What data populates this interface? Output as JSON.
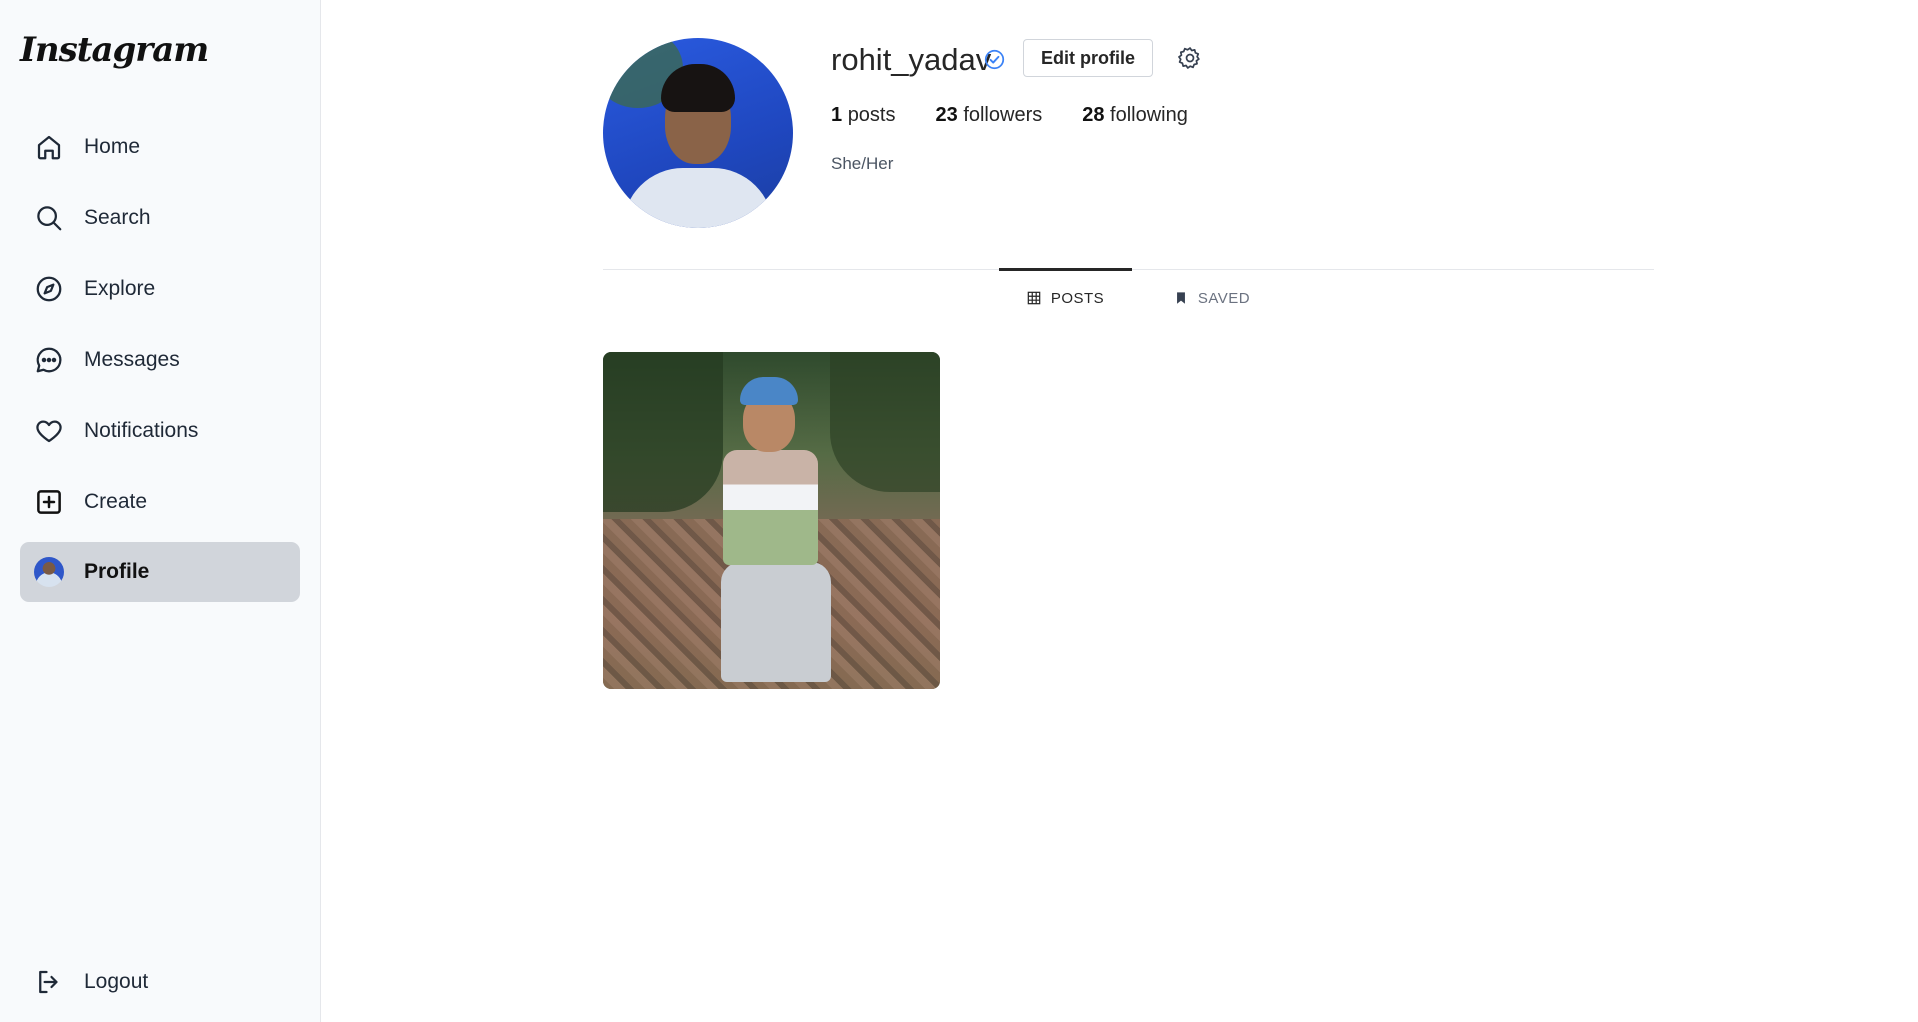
{
  "app": {
    "logo": "Instagram"
  },
  "sidebar": {
    "items": [
      {
        "label": "Home",
        "icon": "home-icon"
      },
      {
        "label": "Search",
        "icon": "search-icon"
      },
      {
        "label": "Explore",
        "icon": "compass-icon"
      },
      {
        "label": "Messages",
        "icon": "message-circle-icon"
      },
      {
        "label": "Notifications",
        "icon": "heart-icon"
      },
      {
        "label": "Create",
        "icon": "plus-square-icon"
      },
      {
        "label": "Profile",
        "icon": "avatar",
        "active": true
      }
    ],
    "logout": {
      "label": "Logout",
      "icon": "logout-icon"
    }
  },
  "profile": {
    "username": "rohit_yadav",
    "verified": true,
    "edit_label": "Edit profile",
    "stats": {
      "posts_count": "1",
      "posts_label": "posts",
      "followers_count": "23",
      "followers_label": "followers",
      "following_count": "28",
      "following_label": "following"
    },
    "bio": "She/Her"
  },
  "tabs": [
    {
      "label": "POSTS",
      "icon": "grid-icon",
      "active": true
    },
    {
      "label": "SAVED",
      "icon": "bookmark-icon",
      "active": false
    }
  ],
  "posts": [
    {
      "description": "photo-thumbnail"
    }
  ],
  "colors": {
    "accent": "#3b82f6",
    "active_nav": "#d1d5db"
  }
}
